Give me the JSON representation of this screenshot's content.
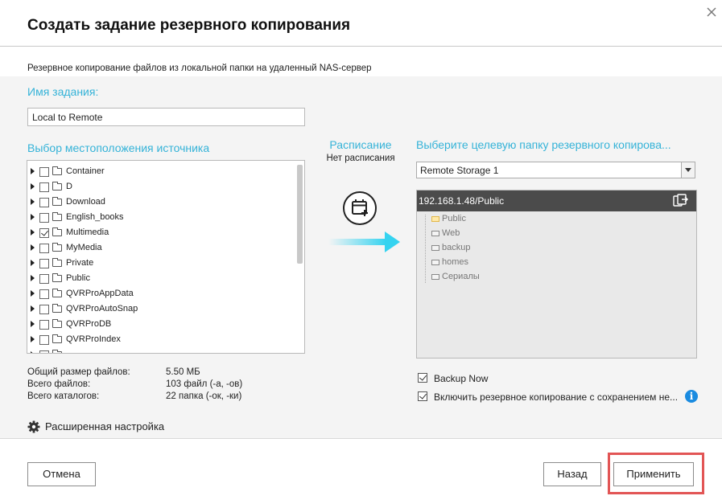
{
  "dialog": {
    "title": "Создать задание резервного копирования",
    "subtitle": "Резервное копирование файлов из локальной папки на удаленный NAS-сервер",
    "close_icon": "close-icon"
  },
  "task": {
    "name_label": "Имя задания:",
    "name_value": "Local to Remote"
  },
  "source": {
    "label": "Выбор местоположения источника",
    "items": [
      {
        "name": "Container",
        "checked": false
      },
      {
        "name": "D",
        "checked": false
      },
      {
        "name": "Download",
        "checked": false
      },
      {
        "name": "English_books",
        "checked": false
      },
      {
        "name": "Multimedia",
        "checked": true
      },
      {
        "name": "MyMedia",
        "checked": false
      },
      {
        "name": "Private",
        "checked": false
      },
      {
        "name": "Public",
        "checked": false
      },
      {
        "name": "QVRProAppData",
        "checked": false
      },
      {
        "name": "QVRProAutoSnap",
        "checked": false
      },
      {
        "name": "QVRProDB",
        "checked": false
      },
      {
        "name": "QVRProIndex",
        "checked": false
      }
    ]
  },
  "stats": {
    "size_label": "Общий размер файлов:",
    "size_value": "5.50 МБ",
    "files_label": "Всего файлов:",
    "files_value": "103 файл (-а, -ов)",
    "dirs_label": "Всего каталогов:",
    "dirs_value": "22 папка (-ок, -ки)"
  },
  "advanced": {
    "label": "Расширенная настройка",
    "icon": "gear-icon"
  },
  "schedule": {
    "title": "Расписание",
    "status": "Нет расписания",
    "icon": "calendar-add-icon"
  },
  "destination": {
    "label": "Выберите целевую папку резервного копирова...",
    "storage_selected": "Remote Storage 1",
    "root_path": "192.168.1.48/Public",
    "folders": [
      {
        "name": "Public",
        "selected": true
      },
      {
        "name": "Web",
        "selected": false
      },
      {
        "name": "backup",
        "selected": false
      },
      {
        "name": "homes",
        "selected": false
      },
      {
        "name": "Сериалы",
        "selected": false
      }
    ]
  },
  "options": {
    "backup_now": "Backup Now",
    "versioning": "Включить резервное копирование с сохранением не..."
  },
  "buttons": {
    "cancel": "Отмена",
    "back": "Назад",
    "apply": "Применить"
  },
  "colors": {
    "accent": "#35b3d8",
    "highlight": "#e25555",
    "info": "#1a8be0"
  }
}
